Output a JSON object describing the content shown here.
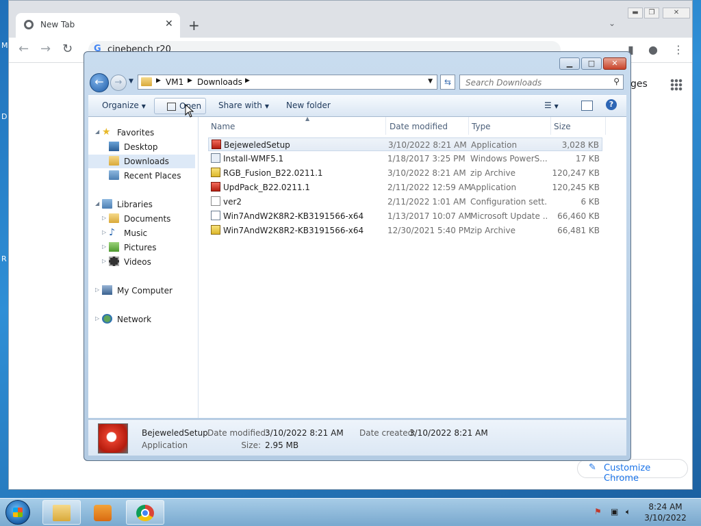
{
  "desktop": {
    "edge_letters": [
      "M",
      "D",
      "R"
    ]
  },
  "chrome": {
    "tab_title": "New Tab",
    "omnibox_text": "cinebench r20",
    "pages_text": "ges",
    "customize_label": "Customize Chrome"
  },
  "explorer": {
    "breadcrumb": [
      "VM1",
      "Downloads"
    ],
    "search_placeholder": "Search Downloads",
    "commands": {
      "organize": "Organize",
      "open": "Open",
      "share_with": "Share with",
      "new_folder": "New folder"
    },
    "nav": {
      "favorites": "Favorites",
      "desktop": "Desktop",
      "downloads": "Downloads",
      "recent_places": "Recent Places",
      "libraries": "Libraries",
      "documents": "Documents",
      "music": "Music",
      "pictures": "Pictures",
      "videos": "Videos",
      "my_computer": "My Computer",
      "network": "Network"
    },
    "columns": {
      "name": "Name",
      "date_modified": "Date modified",
      "type": "Type",
      "size": "Size"
    },
    "files": [
      {
        "name": "BejeweledSetup",
        "date": "3/10/2022 8:21 AM",
        "type": "Application",
        "size": "3,028 KB",
        "icon": "app-icon"
      },
      {
        "name": "Install-WMF5.1",
        "date": "1/18/2017 3:25 PM",
        "type": "Windows PowerS...",
        "size": "17 KB",
        "icon": "powershell-icon"
      },
      {
        "name": "RGB_Fusion_B22.0211.1",
        "date": "3/10/2022 8:21 AM",
        "type": "zip Archive",
        "size": "120,247 KB",
        "icon": "zip-icon"
      },
      {
        "name": "UpdPack_B22.0211.1",
        "date": "2/11/2022 12:59 AM",
        "type": "Application",
        "size": "120,245 KB",
        "icon": "app-icon"
      },
      {
        "name": "ver2",
        "date": "2/11/2022 1:01 AM",
        "type": "Configuration sett...",
        "size": "6 KB",
        "icon": "config-icon"
      },
      {
        "name": "Win7AndW2K8R2-KB3191566-x64",
        "date": "1/13/2017 10:07 AM",
        "type": "Microsoft Update ...",
        "size": "66,460 KB",
        "icon": "msu-icon"
      },
      {
        "name": "Win7AndW2K8R2-KB3191566-x64",
        "date": "12/30/2021 5:40 PM",
        "type": "zip Archive",
        "size": "66,481 KB",
        "icon": "zip-icon"
      }
    ],
    "details": {
      "name": "BejeweledSetup",
      "type": "Application",
      "date_modified_label": "Date modified:",
      "date_modified": "3/10/2022 8:21 AM",
      "date_created_label": "Date created:",
      "date_created": "3/10/2022 8:21 AM",
      "size_label": "Size:",
      "size": "2.95 MB"
    }
  },
  "taskbar": {
    "time": "8:24 AM",
    "date": "3/10/2022"
  }
}
